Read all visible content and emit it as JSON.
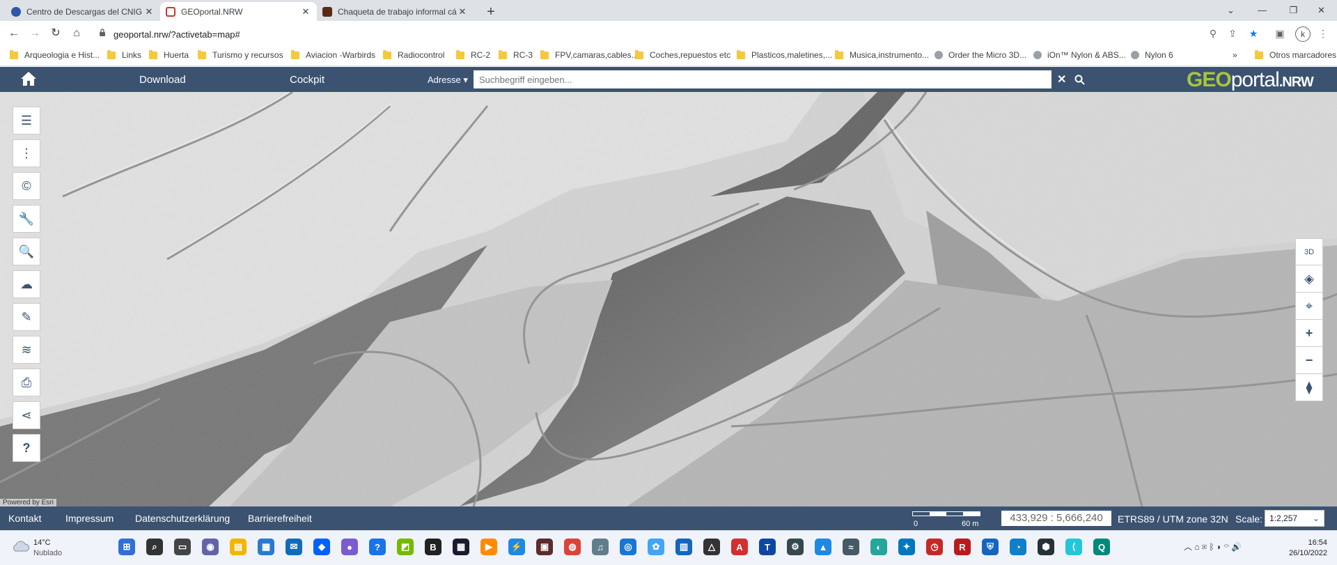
{
  "browser": {
    "tabs": [
      {
        "title": "Centro de Descargas del CNIG (IG",
        "favicon_color": "#2f57a8",
        "active": false
      },
      {
        "title": "GEOportal.NRW",
        "favicon_color": "#c23a2b",
        "active": true
      },
      {
        "title": "Chaqueta de trabajo informal cálid",
        "favicon_color": "#5a2a14",
        "active": false
      }
    ],
    "url": "geoportal.nrw/?activetab=map#",
    "profile_initial": "k",
    "bookmarks": [
      {
        "label": "Arqueologia e Hist...",
        "type": "folder"
      },
      {
        "label": "Links",
        "type": "folder"
      },
      {
        "label": "Huerta",
        "type": "folder"
      },
      {
        "label": "Turismo y recursos",
        "type": "folder"
      },
      {
        "label": "Aviacion -Warbirds",
        "type": "folder"
      },
      {
        "label": "Radiocontrol",
        "type": "folder"
      },
      {
        "label": "RC-2",
        "type": "folder"
      },
      {
        "label": "RC-3",
        "type": "folder"
      },
      {
        "label": "FPV,camaras,cables...",
        "type": "folder"
      },
      {
        "label": "Coches,repuestos etc",
        "type": "folder"
      },
      {
        "label": "Plasticos,maletines,...",
        "type": "folder"
      },
      {
        "label": "Musica,instrumento...",
        "type": "folder"
      },
      {
        "label": "Order the Micro 3D...",
        "type": "page"
      },
      {
        "label": "iOn™ Nylon & ABS...",
        "type": "page"
      },
      {
        "label": "Nylon 6",
        "type": "page"
      }
    ],
    "bookmarks_overflow": "»",
    "other_bookmarks": "Otros marcadores"
  },
  "app": {
    "nav": {
      "download": "Download",
      "cockpit": "Cockpit"
    },
    "search": {
      "mode": "Adresse",
      "placeholder": "Suchbegriff eingeben..."
    },
    "logo": {
      "part1": "GEO",
      "part2": "portal",
      "part3": ".NRW",
      "color1": "#a8c63a",
      "color2": "#ffffff"
    },
    "left_tools": [
      "list-icon",
      "more-vertical-icon",
      "copyright-icon",
      "wrench-icon",
      "search-document-icon",
      "download-cloud-icon",
      "pencil-icon",
      "layers-settings-icon",
      "print-icon",
      "share-icon",
      "help-icon"
    ],
    "help_glyph": "?",
    "right_tools": {
      "three_d": "3D"
    },
    "attribution": "Powered by Esri",
    "footer": {
      "links": [
        "Kontakt",
        "Impressum",
        "Datenschutzerklärung",
        "Barrierefreiheit"
      ],
      "scalebar": {
        "start": "0",
        "end": "60 m"
      },
      "coordinates": "433,929 : 5,666,240",
      "crs": "ETRS89 / UTM zone 32N",
      "scale_label": "Scale:",
      "scale_value": "1:2,257"
    }
  },
  "taskbar": {
    "weather": {
      "temp": "14°C",
      "condition": "Nublado"
    },
    "clock": {
      "time": "16:54",
      "date": "26/10/2022"
    }
  },
  "colors": {
    "header_bg": "#3b5371",
    "tab_strip": "#dee1e6",
    "taskbar_bg": "#f0f3f9"
  }
}
